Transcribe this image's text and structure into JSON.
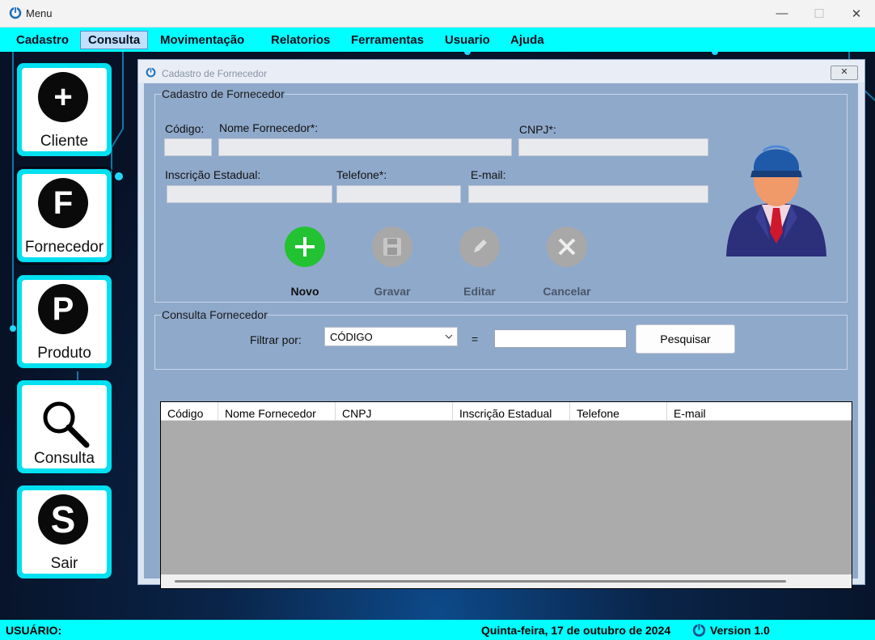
{
  "window": {
    "title": "Menu",
    "minimize": "—",
    "maximize": "☐",
    "close": "✕"
  },
  "menu": [
    "Cadastro",
    "Consulta",
    "Movimentação",
    "Relatorios",
    "Ferramentas",
    "Usuario",
    "Ajuda"
  ],
  "menu_active": "Consulta",
  "sidebar": {
    "cliente": {
      "label": "Cliente",
      "glyph": "+"
    },
    "fornecedor": {
      "label": "Fornecedor",
      "glyph": "F"
    },
    "produto": {
      "label": "Produto",
      "glyph": "P"
    },
    "consulta": {
      "label": "Consulta"
    },
    "sair": {
      "label": "Sair",
      "glyph": "S"
    }
  },
  "child": {
    "title": "Cadastro de Fornecedor",
    "close": "✕",
    "cadastro_group": "Cadastro de Fornecedor",
    "labels": {
      "codigo": "Código:",
      "nome": "Nome Fornecedor*:",
      "cnpj": "CNPJ*:",
      "ie": "Inscrição Estadual:",
      "telefone": "Telefone*:",
      "email": "E-mail:"
    },
    "values": {
      "codigo": "",
      "nome": "",
      "cnpj": "",
      "ie": "",
      "telefone": "",
      "email": ""
    },
    "actions": {
      "novo": "Novo",
      "gravar": "Gravar",
      "editar": "Editar",
      "cancelar": "Cancelar"
    },
    "consulta_group": "Consulta Fornecedor",
    "filter_label": "Filtrar por:",
    "filter_value": "CÓDIGO",
    "equals": "=",
    "search_value": "",
    "search_button": "Pesquisar",
    "grid_columns": [
      "Código",
      "Nome Fornecedor",
      "CNPJ",
      "Inscrição Estadual",
      "Telefone",
      "E-mail"
    ]
  },
  "status": {
    "user_label": "USUÁRIO:",
    "date": "Quinta-feira, 17 de outubro de 2024",
    "version": "Version 1.0"
  },
  "colors": {
    "accent": "#00ffff",
    "novo": "#22c232",
    "disabled": "#a8a8a8"
  }
}
